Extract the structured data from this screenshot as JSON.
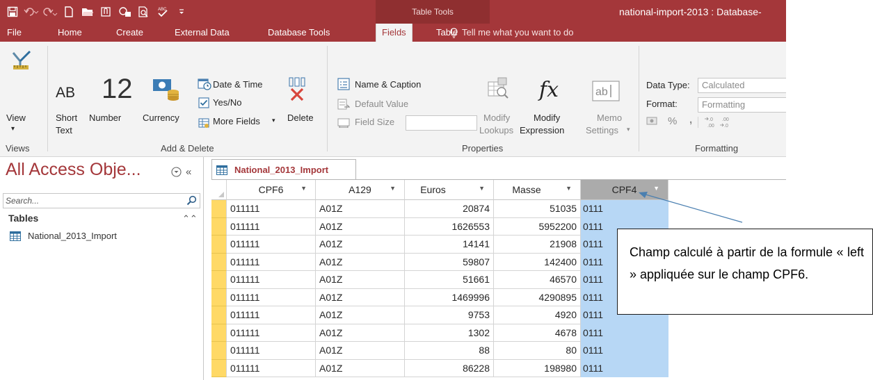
{
  "titlebar": {
    "table_tools": "Table Tools",
    "doc_title": "national-import-2013 : Database-"
  },
  "colors": {
    "accent": "#a4373a",
    "selection": "#b7d7f5",
    "record_selector": "#ffd966"
  },
  "tabs": [
    "File",
    "Home",
    "Create",
    "External Data",
    "Database Tools",
    "Fields",
    "Table"
  ],
  "active_tab": "Fields",
  "tell_me": "Tell me what you want to do",
  "ribbon": {
    "views": {
      "view_label": "View",
      "group": "Views"
    },
    "add_delete": {
      "short_text_ab": "AB",
      "short_text_1": "Short",
      "short_text_2": "Text",
      "number_big": "12",
      "number_label": "Number",
      "currency_label": "Currency",
      "date_time": "Date & Time",
      "yes_no": "Yes/No",
      "more_fields": "More Fields",
      "delete": "Delete",
      "group": "Add & Delete"
    },
    "properties": {
      "name_caption": "Name & Caption",
      "default_value": "Default Value",
      "field_size": "Field Size",
      "modify_lookups_1": "Modify",
      "modify_lookups_2": "Lookups",
      "modify_expr_1": "Modify",
      "modify_expr_2": "Expression",
      "memo_1": "Memo",
      "memo_2": "Settings",
      "group": "Properties"
    },
    "formatting": {
      "data_type_label": "Data Type:",
      "data_type_value": "Calculated",
      "format_label": "Format:",
      "format_value": "Formatting",
      "percent": "%",
      "comma": ",",
      "group": "Formatting"
    }
  },
  "nav": {
    "title": "All Access Obje...",
    "search_placeholder": "Search...",
    "group": "Tables",
    "items": [
      "National_2013_Import"
    ]
  },
  "sheet": {
    "tab_label": "National_2013_Import",
    "columns": [
      "CPF6",
      "A129",
      "Euros",
      "Masse",
      "CPF4"
    ],
    "rows": [
      [
        "011111",
        "A01Z",
        "20874",
        "51035",
        "0111"
      ],
      [
        "011111",
        "A01Z",
        "1626553",
        "5952200",
        "0111"
      ],
      [
        "011111",
        "A01Z",
        "14141",
        "21908",
        "0111"
      ],
      [
        "011111",
        "A01Z",
        "59807",
        "142400",
        "0111"
      ],
      [
        "011111",
        "A01Z",
        "51661",
        "46570",
        "0111"
      ],
      [
        "011111",
        "A01Z",
        "1469996",
        "4290895",
        "0111"
      ],
      [
        "011111",
        "A01Z",
        "9753",
        "4920",
        "0111"
      ],
      [
        "011111",
        "A01Z",
        "1302",
        "4678",
        "0111"
      ],
      [
        "011111",
        "A01Z",
        "88",
        "80",
        "0111"
      ],
      [
        "011111",
        "A01Z",
        "86228",
        "198980",
        "0111"
      ]
    ]
  },
  "callout": {
    "text": "Champ calculé à partir de la formule « left » appliquée sur le champ CPF6."
  }
}
